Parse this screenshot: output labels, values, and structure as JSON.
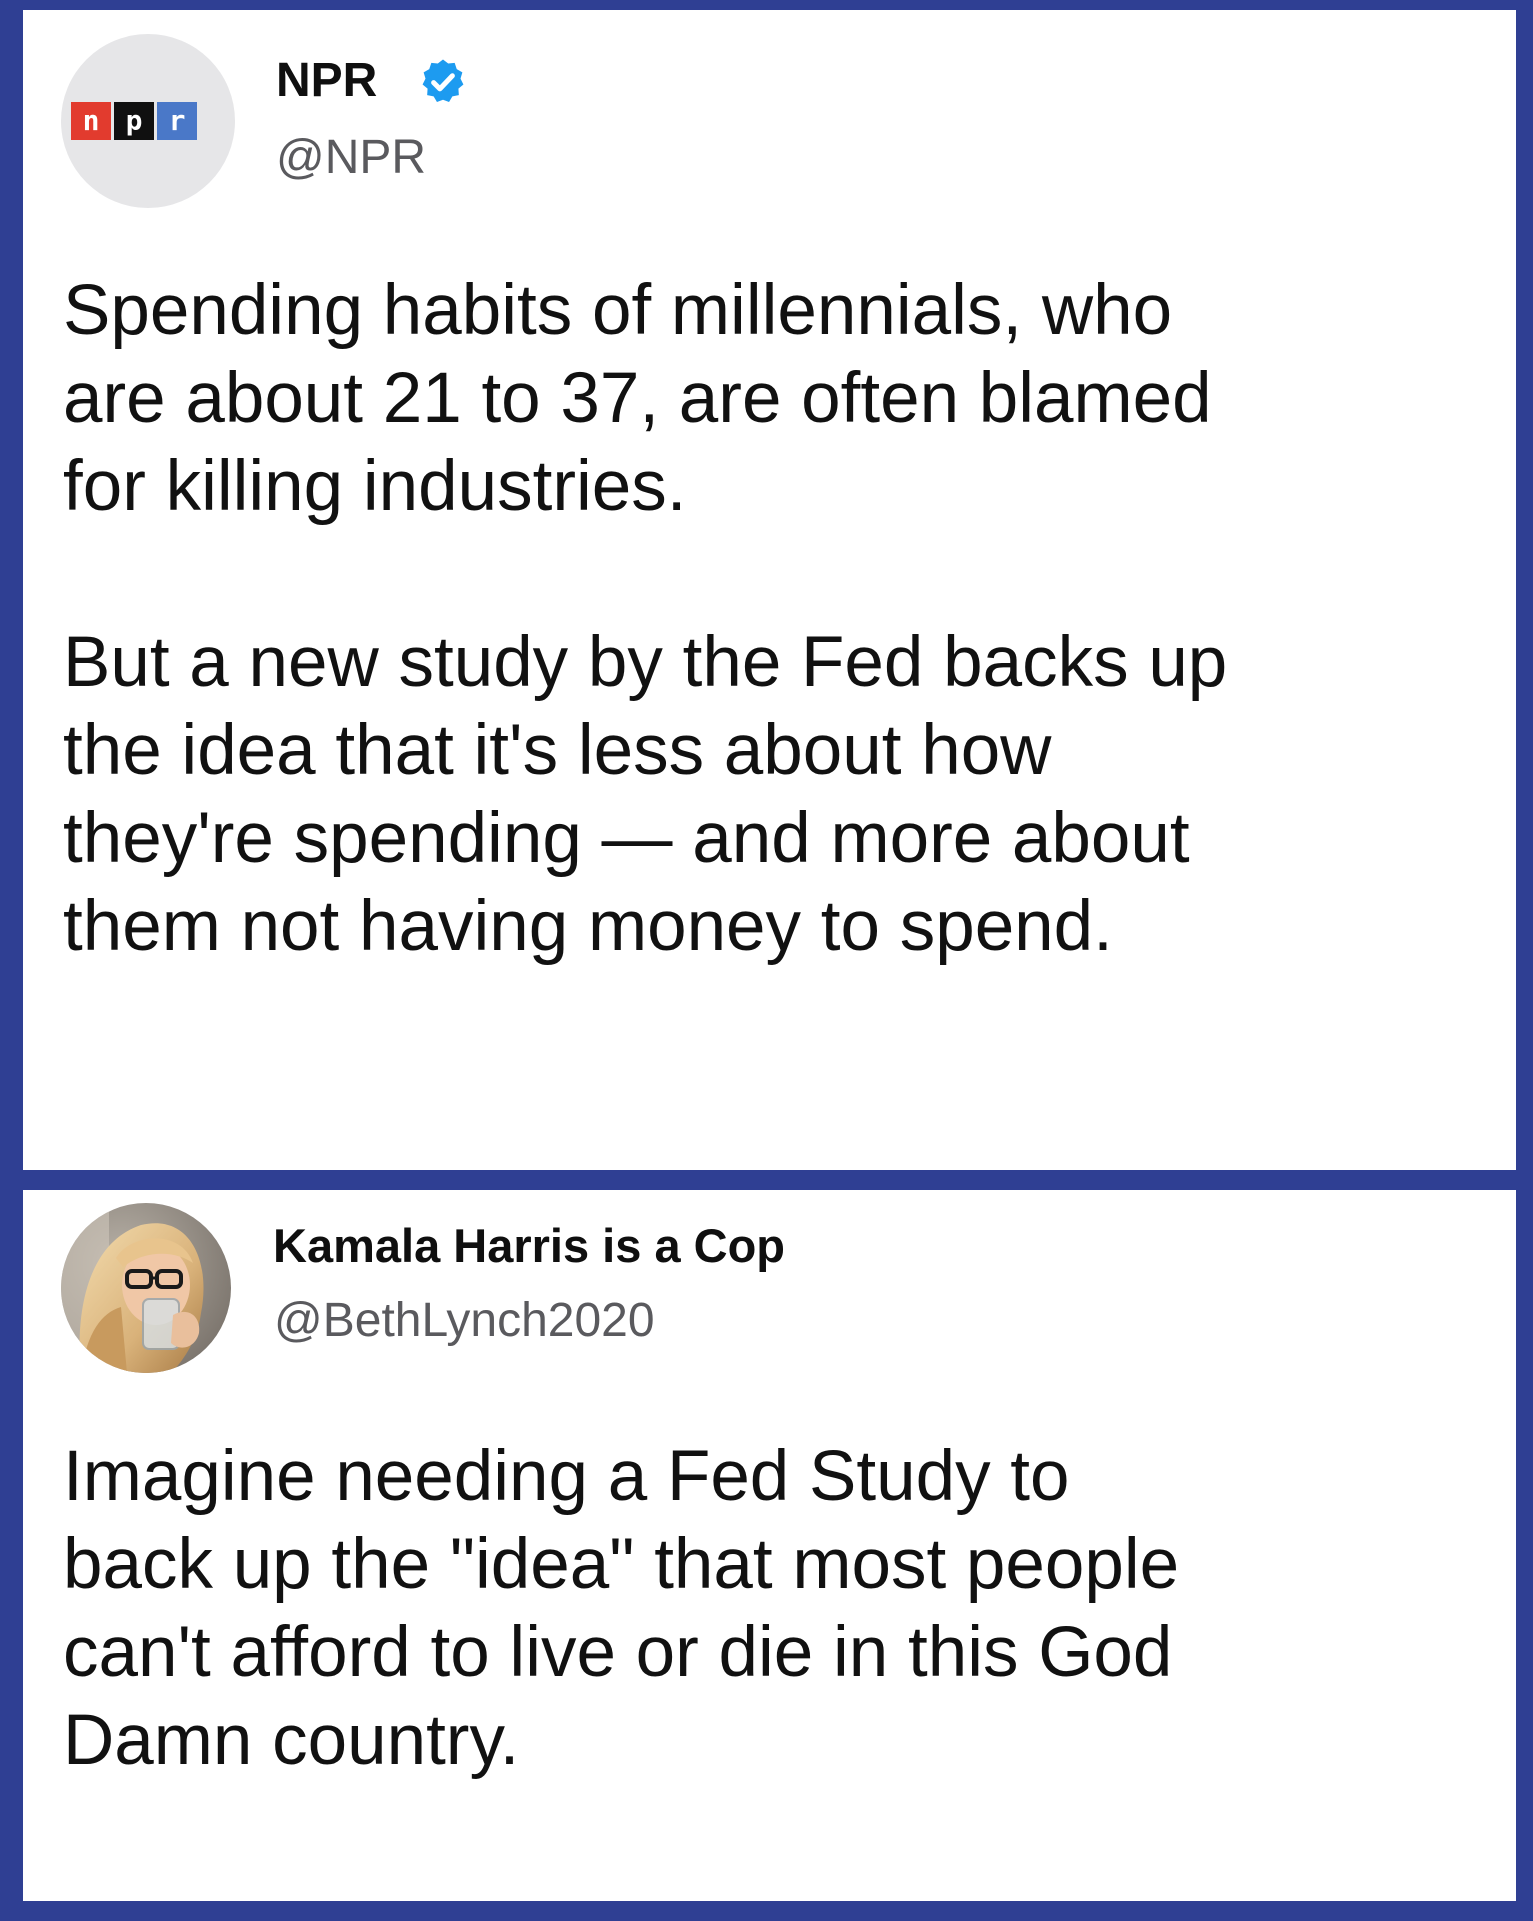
{
  "tweets": [
    {
      "display_name": "NPR",
      "verified": true,
      "handle": "@NPR",
      "avatar": {
        "type": "logo",
        "letters": [
          "n",
          "p",
          "r"
        ],
        "colors": [
          "#e23b2e",
          "#101010",
          "#4a78c8"
        ]
      },
      "text": "Spending habits of millennials, who\nare about 21 to 37, are often blamed\nfor killing industries.\n\nBut a new study by the Fed backs up\nthe idea that it's less about how\nthey're spending — and more about\nthem not having money to spend."
    },
    {
      "display_name": "Kamala Harris is a Cop",
      "verified": false,
      "handle": "@BethLynch2020",
      "avatar": {
        "type": "photo"
      },
      "text": "Imagine needing a Fed Study to\nback up the \"idea\" that most people\ncan't afford to live or die in this God\nDamn country."
    }
  ],
  "colors": {
    "background_frame": "#2f3f93",
    "card": "#ffffff",
    "verified_badge": "#1d9bf0",
    "handle": "#5a5a5e"
  }
}
